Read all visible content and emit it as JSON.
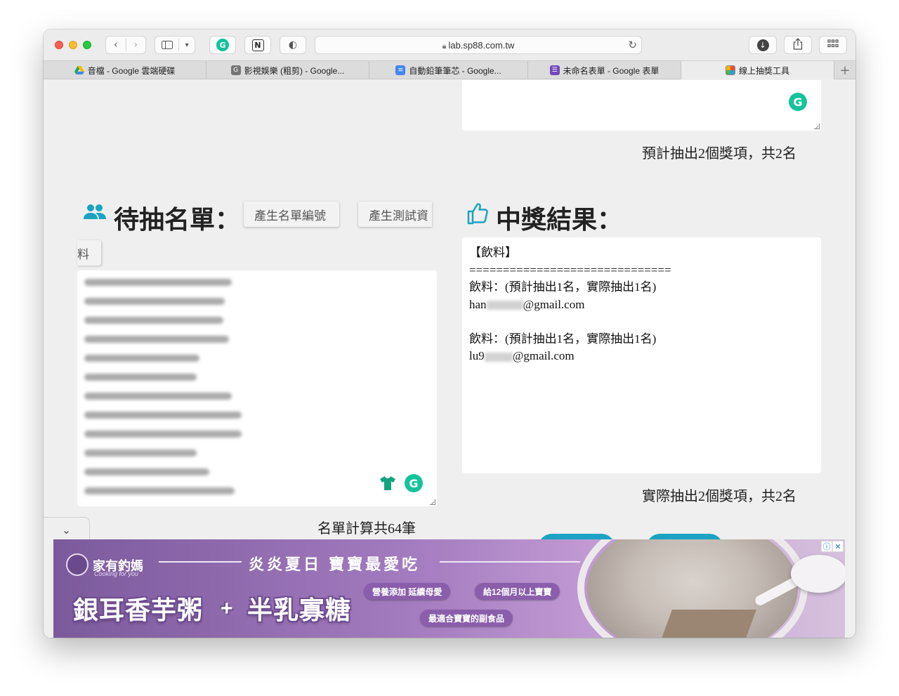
{
  "browser": {
    "url": "lab.sp88.com.tw",
    "tabs": [
      {
        "label": "音檔 - Google 雲端硬碟",
        "icon": "google-drive-icon",
        "color": "#1fa463"
      },
      {
        "label": "影視娛樂 (粗剪) - Google...",
        "icon": "g-letter-icon",
        "color": "#757575"
      },
      {
        "label": "自動鉛筆筆芯 - Google...",
        "icon": "google-docs-icon",
        "color": "#4285f4"
      },
      {
        "label": "未命名表單 - Google 表單",
        "icon": "google-forms-icon",
        "color": "#7248b9"
      },
      {
        "label": "線上抽獎工具",
        "icon": "lottery-tool-icon",
        "color": "#f2b600"
      }
    ]
  },
  "top_summary": "預計抽出2個獎項，共2名",
  "candidates": {
    "title": "待抽名單：",
    "btn_generate_ids": "產生名單編號",
    "btn_generate_test": "產生測試資",
    "btn_generate_test_cont": "料",
    "count_label": "名單計算共64筆"
  },
  "results": {
    "title": "中獎結果：",
    "category_header": "【飲料】",
    "divider": "==============================",
    "entries": [
      {
        "line": "飲料：(預計抽出1名，實際抽出1名)",
        "email_prefix": "han",
        "email_suffix": "@gmail.com"
      },
      {
        "line": "飲料：(預計抽出1名，實際抽出1名)",
        "email_prefix": "lu9",
        "email_suffix": "@gmail.com"
      }
    ],
    "summary": "實際抽出2個獎項，共2名"
  },
  "ad": {
    "brand": "家有釣媽",
    "brand_sub": "Cooking for you",
    "headline": "炎炎夏日 寶寶最愛吃",
    "product": "銀耳香芋粥",
    "product_2": "半乳寡糖",
    "pill_1": "營養添加 延續母愛",
    "pill_2": "給12個月以上寶寶",
    "pill_3": "最適合寶寶的副食品"
  },
  "colors": {
    "accent_teal": "#1aa3c2",
    "grammarly": "#15c39a"
  }
}
